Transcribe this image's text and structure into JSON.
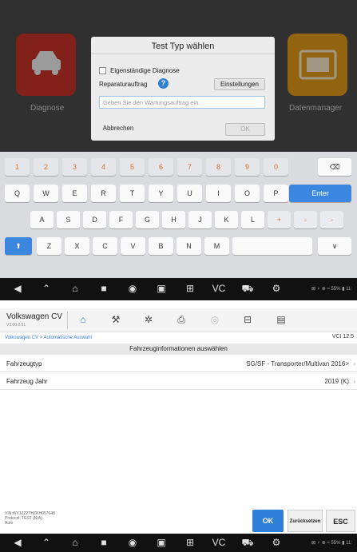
{
  "dialog_screen": {
    "tiles": {
      "left_label": "Diagnose",
      "right_label": "Datenmanager"
    },
    "dialog": {
      "title": "Test Typ wählen",
      "standalone_label": "Eigenständige Diagnose",
      "repair_label": "Reparaturauftrag",
      "settings_button": "Einstellungen",
      "input_placeholder": "Geben Sie den Wartungsauftrag ein.",
      "cancel_button": "Abbrechen",
      "ok_button": "OK"
    },
    "keyboard": {
      "row1": [
        "1",
        "2",
        "3",
        "4",
        "5",
        "6",
        "7",
        "8",
        "9",
        "0"
      ],
      "backspace": "⌫",
      "row2": [
        "Q",
        "W",
        "E",
        "R",
        "T",
        "Y",
        "U",
        "I",
        "O",
        "P"
      ],
      "enter": "Enter",
      "row3": [
        "A",
        "S",
        "D",
        "F",
        "G",
        "H",
        "J",
        "K",
        "L",
        "+",
        "-",
        "-"
      ],
      "row4": [
        "Z",
        "X",
        "C",
        "V",
        "B",
        "N",
        "M"
      ],
      "shift": "⬆",
      "hide": "∨"
    },
    "status": "⊠ ♀ ⊕ ≈ 55% ▮ 11:"
  },
  "vehicle_screen": {
    "header": {
      "title": "Volkswagen CV",
      "version": "V3.00.0.51"
    },
    "breadcrumb": "Volkswagen CV > Automatische Auswahl",
    "vci": "VCI 12:5",
    "section_title": "Fahrzeuginformationen auswählen",
    "rows": [
      {
        "label": "Fahrzeugtyp",
        "value": "SG/SF - Transporter/Multivan 2016>"
      },
      {
        "label": "Fahrzeug Jahr",
        "value": "2019 (K)"
      }
    ],
    "vin_info": [
      "VIN:WV1ZZZ7HZKH057648",
      "Protocol: TEST (N/A)",
      "Auto"
    ],
    "buttons": {
      "ok": "OK",
      "reset": "Zurücksetzen",
      "esc": "ESC"
    },
    "status": "⊠ ♀ ⊕ ≈ 55% ▮ 11:"
  },
  "nav_icons": [
    "back-icon",
    "home-icon",
    "house-icon",
    "recent-icon",
    "chrome-icon",
    "camera-icon",
    "screen-icon",
    "vci-icon",
    "car-icon",
    "car-service-icon"
  ],
  "colors": {
    "accent": "#2f7fd8",
    "red_tile": "#c83428",
    "orange_tile": "#e09a18"
  }
}
